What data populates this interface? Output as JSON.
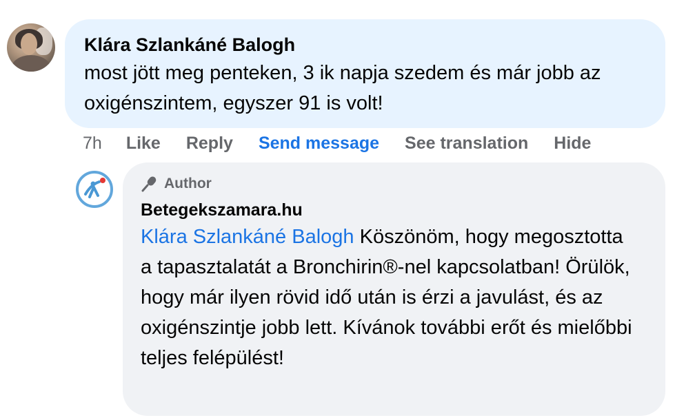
{
  "comment": {
    "author": "Klára Szlankáné Balogh",
    "text": "most jött meg penteken, 3 ik napja szedem és már jobb az oxigénszintem, egyszer 91 is volt!",
    "bubble_color": "#e7f3ff"
  },
  "actions": {
    "time": "7h",
    "like": "Like",
    "reply": "Reply",
    "send_message": "Send message",
    "see_translation": "See translation",
    "hide": "Hide",
    "link_color": "#1b74e4"
  },
  "reply": {
    "badge_icon": "microphone-icon",
    "badge_label": "Author",
    "author": "Betegekszamara.hu",
    "mention": "Klára Szlankáné Balogh",
    "text": " Köszönöm, hogy megosztotta a tapasztalatát a Bronchirin®-nel kapcsolatban! Örülök, hogy már ilyen rövid idő után is érzi a javulást, és az oxigénszintje jobb lett. Kívánok további erőt és mielőbbi teljes felépülést!",
    "bubble_color": "#f0f2f5"
  }
}
